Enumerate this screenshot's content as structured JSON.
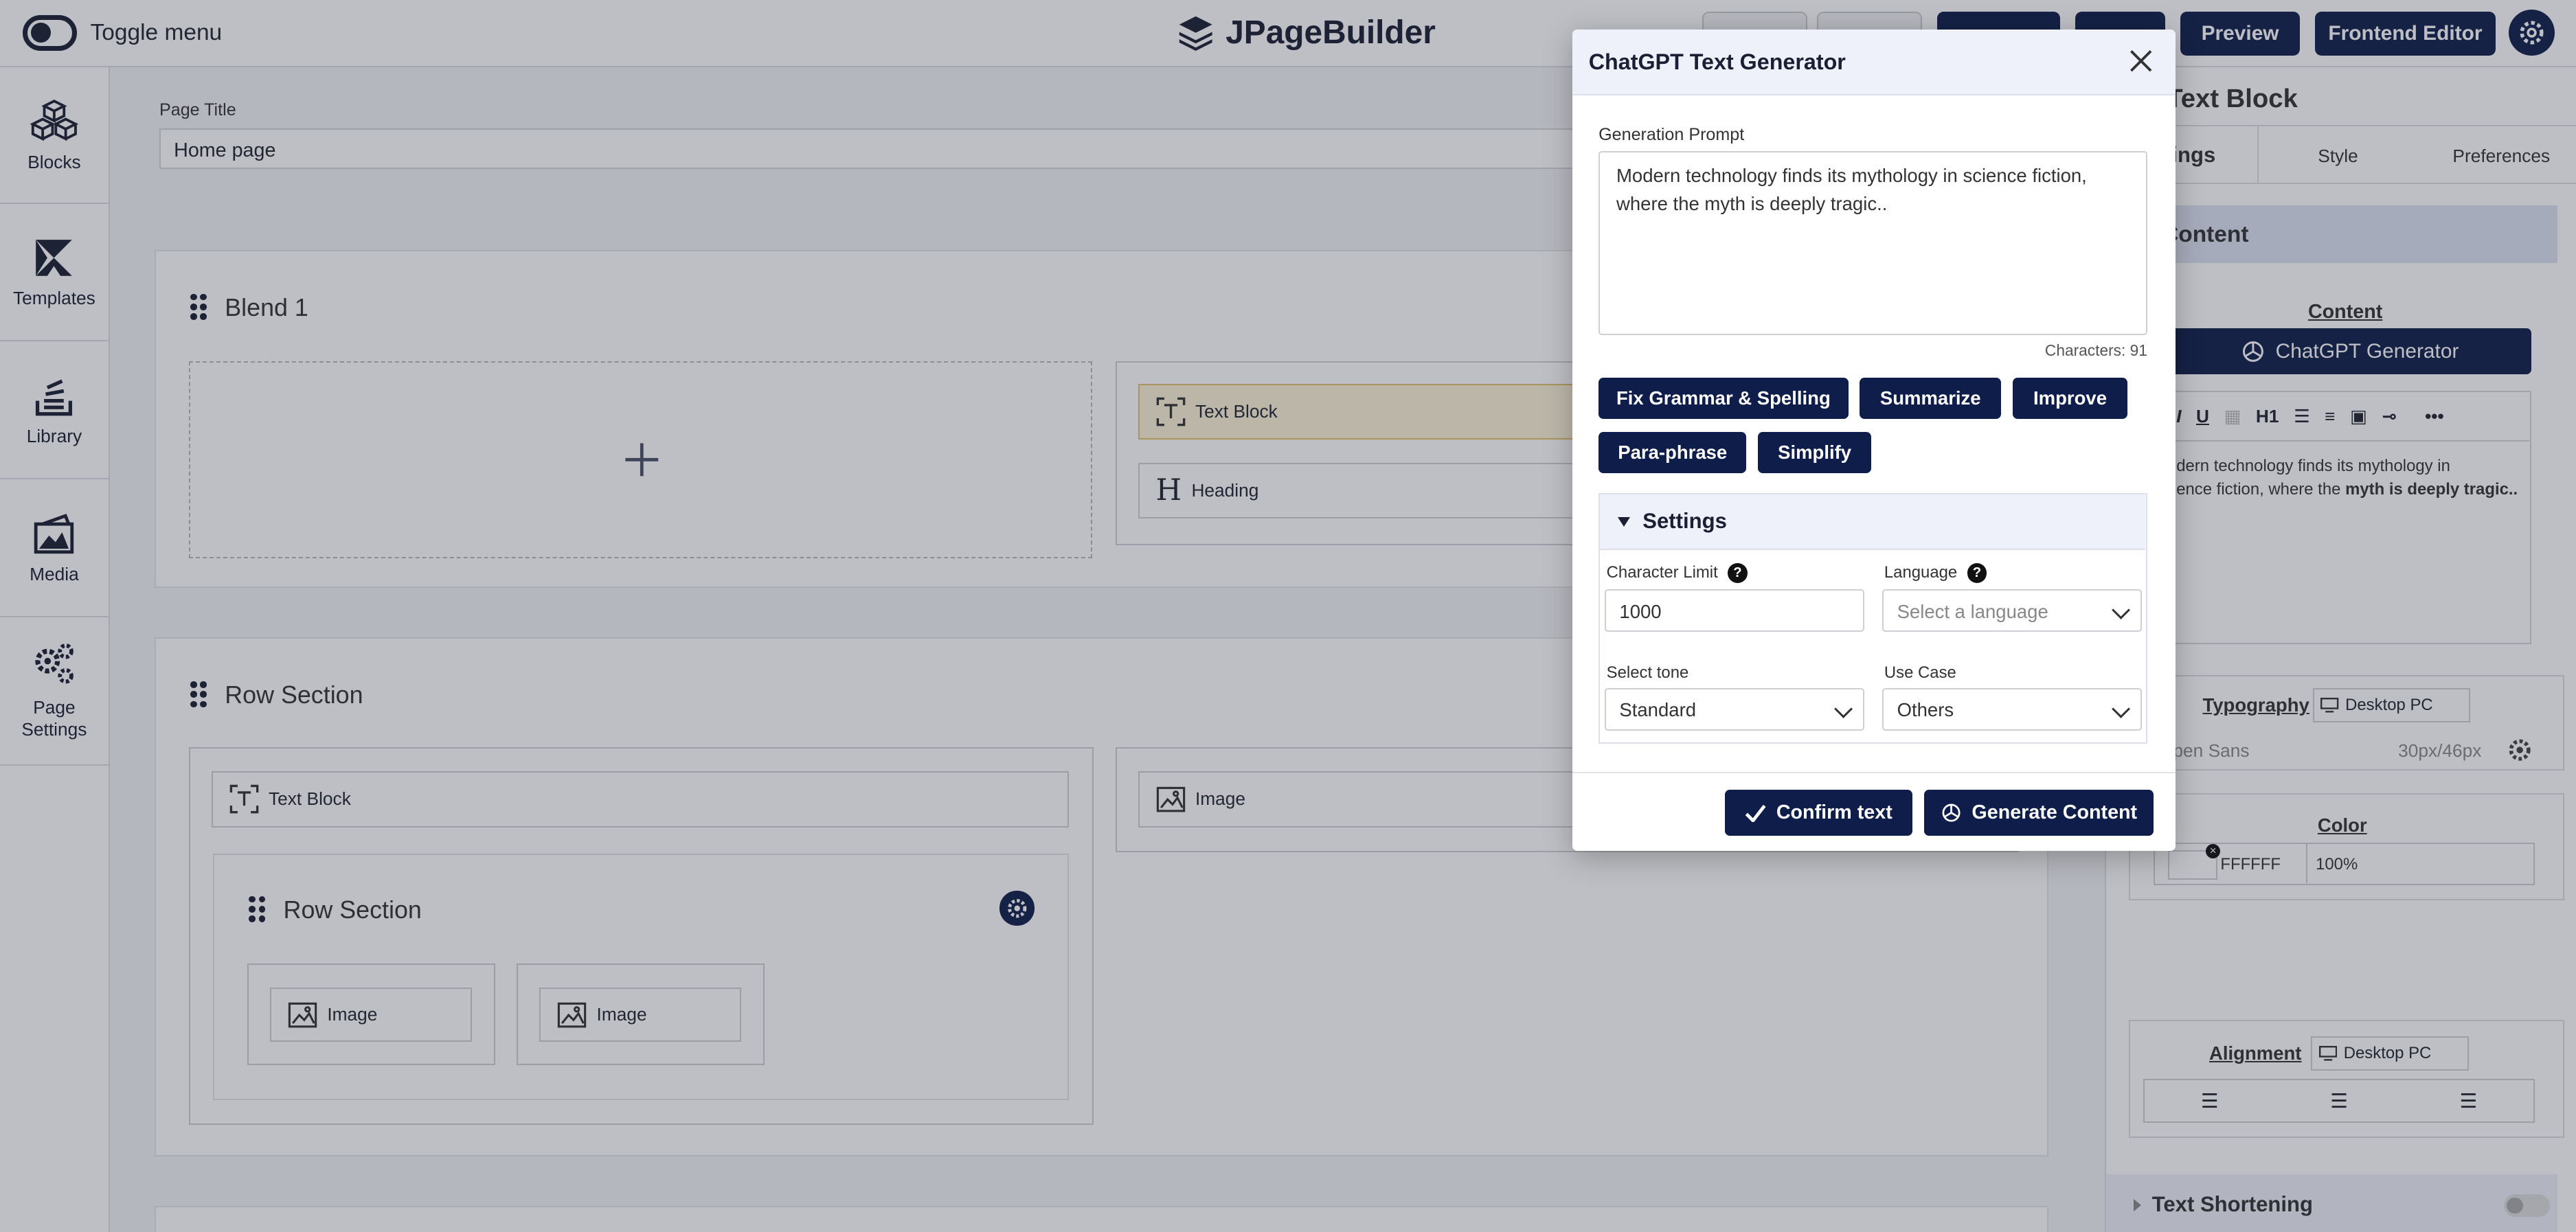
{
  "topbar": {
    "toggle_label": "Toggle menu",
    "logo_text": "JPageBuilder",
    "preview_label": "Preview",
    "frontend_editor_label": "Frontend Editor"
  },
  "sidebar": {
    "items": [
      {
        "label": "Blocks",
        "icon": "cubes-icon"
      },
      {
        "label": "Templates",
        "icon": "templates-icon"
      },
      {
        "label": "Library",
        "icon": "library-icon"
      },
      {
        "label": "Media",
        "icon": "media-icon"
      },
      {
        "label": "Page Settings",
        "icon": "gears-icon"
      }
    ]
  },
  "page": {
    "title_label": "Page Title",
    "title_value": "Home page"
  },
  "canvas": {
    "section1": {
      "title": "Blend 1",
      "blocks": [
        "Text Block",
        "Heading"
      ]
    },
    "section2": {
      "title": "Row Section",
      "blocks": [
        "Text Block",
        "Image"
      ],
      "inner": {
        "title": "Row Section",
        "blocks": [
          "Image",
          "Image"
        ]
      }
    }
  },
  "right_panel": {
    "title": "Text Block",
    "tabs": [
      "ings",
      "Style",
      "Preferences"
    ],
    "content_header": "Content",
    "content_label": "Content",
    "generator_button": "ChatGPT Generator",
    "editor_text_1": "dern technology finds its mythology in",
    "editor_text_2": "ence fiction, where the",
    "editor_text_bold": "myth is deeply tragic..",
    "typography_label": "Typography",
    "typography_device": "Desktop PC",
    "font_name": "pen Sans",
    "font_size": "30px/46px",
    "color_label": "Color",
    "color_hex": "FFFFFF",
    "color_opacity": "100%",
    "alignment_label": "Alignment",
    "alignment_device": "Desktop PC",
    "text_shortening_label": "Text Shortening"
  },
  "modal": {
    "title": "ChatGPT Text Generator",
    "prompt_label": "Generation Prompt",
    "prompt_value": "Modern technology finds its mythology in science fiction, where the myth is deeply tragic..",
    "characters": "Characters: 91",
    "actions": [
      "Fix Grammar & Spelling",
      "Summarize",
      "Improve",
      "Para-phrase",
      "Simplify"
    ],
    "settings_title": "Settings",
    "char_limit_label": "Character Limit",
    "char_limit_value": "1000",
    "language_label": "Language",
    "language_placeholder": "Select a language",
    "tone_label": "Select tone",
    "tone_value": "Standard",
    "use_case_label": "Use Case",
    "use_case_value": "Others",
    "confirm_label": "Confirm text",
    "generate_label": "Generate Content"
  },
  "colors": {
    "primary": "#0e1d4a",
    "active_block": "#fdf3d8"
  }
}
